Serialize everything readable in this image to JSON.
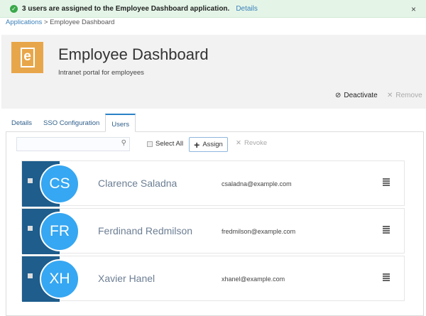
{
  "banner": {
    "message": "3 users are assigned to the Employee Dashboard application.",
    "link": "Details",
    "close": "×"
  },
  "breadcrumb": {
    "root": "Applications",
    "sep": ">",
    "current": "Employee Dashboard"
  },
  "app": {
    "logo_letter": "e",
    "title": "Employee Dashboard",
    "description": "Intranet portal for employees"
  },
  "actions": {
    "deactivate": "Deactivate",
    "remove": "Remove"
  },
  "tabs": [
    {
      "label": "Details"
    },
    {
      "label": "SSO Configuration"
    },
    {
      "label": "Users",
      "active": true
    }
  ],
  "toolbar": {
    "search_placeholder": "",
    "select_all": "Select All",
    "assign": "Assign",
    "revoke": "Revoke"
  },
  "users": [
    {
      "initials": "CS",
      "name": "Clarence Saladna",
      "email": "csaladna@example.com"
    },
    {
      "initials": "FR",
      "name": "Ferdinand Redmilson",
      "email": "fredmilson@example.com"
    },
    {
      "initials": "XH",
      "name": "Xavier Hanel",
      "email": "xhanel@example.com"
    }
  ]
}
